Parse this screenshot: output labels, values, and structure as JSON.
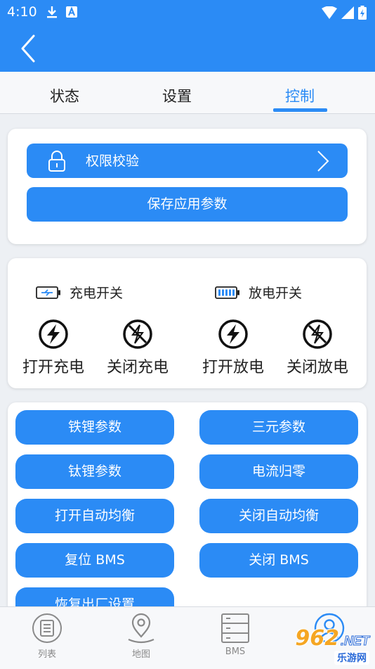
{
  "status_bar": {
    "time": "4:10"
  },
  "tabs": [
    {
      "label": "状态"
    },
    {
      "label": "设置"
    },
    {
      "label": "控制"
    }
  ],
  "auth": {
    "label": "权限校验"
  },
  "save": {
    "label": "保存应用参数"
  },
  "switches": {
    "charge_title": "充电开关",
    "discharge_title": "放电开关",
    "open_charge": "打开充电",
    "close_charge": "关闭充电",
    "open_discharge": "打开放电",
    "close_discharge": "关闭放电"
  },
  "actions": [
    "铁锂参数",
    "三元参数",
    "钛锂参数",
    "电流归零",
    "打开自动均衡",
    "关闭自动均衡",
    "复位 BMS",
    "关闭 BMS",
    "恢复出厂设置"
  ],
  "bottom_nav": [
    {
      "label": "列表",
      "icon": "list-icon"
    },
    {
      "label": "地图",
      "icon": "map-pin-icon"
    },
    {
      "label": "BMS",
      "icon": "server-icon"
    },
    {
      "label": "",
      "icon": "user-icon"
    }
  ],
  "watermark": {
    "number": "962",
    "suffix": ".NET",
    "text": "乐游网"
  },
  "colors": {
    "primary": "#2b8bf5",
    "background": "#edf0f4",
    "inactive": "#8a8a8a",
    "watermark_orange": "#f5a623"
  }
}
